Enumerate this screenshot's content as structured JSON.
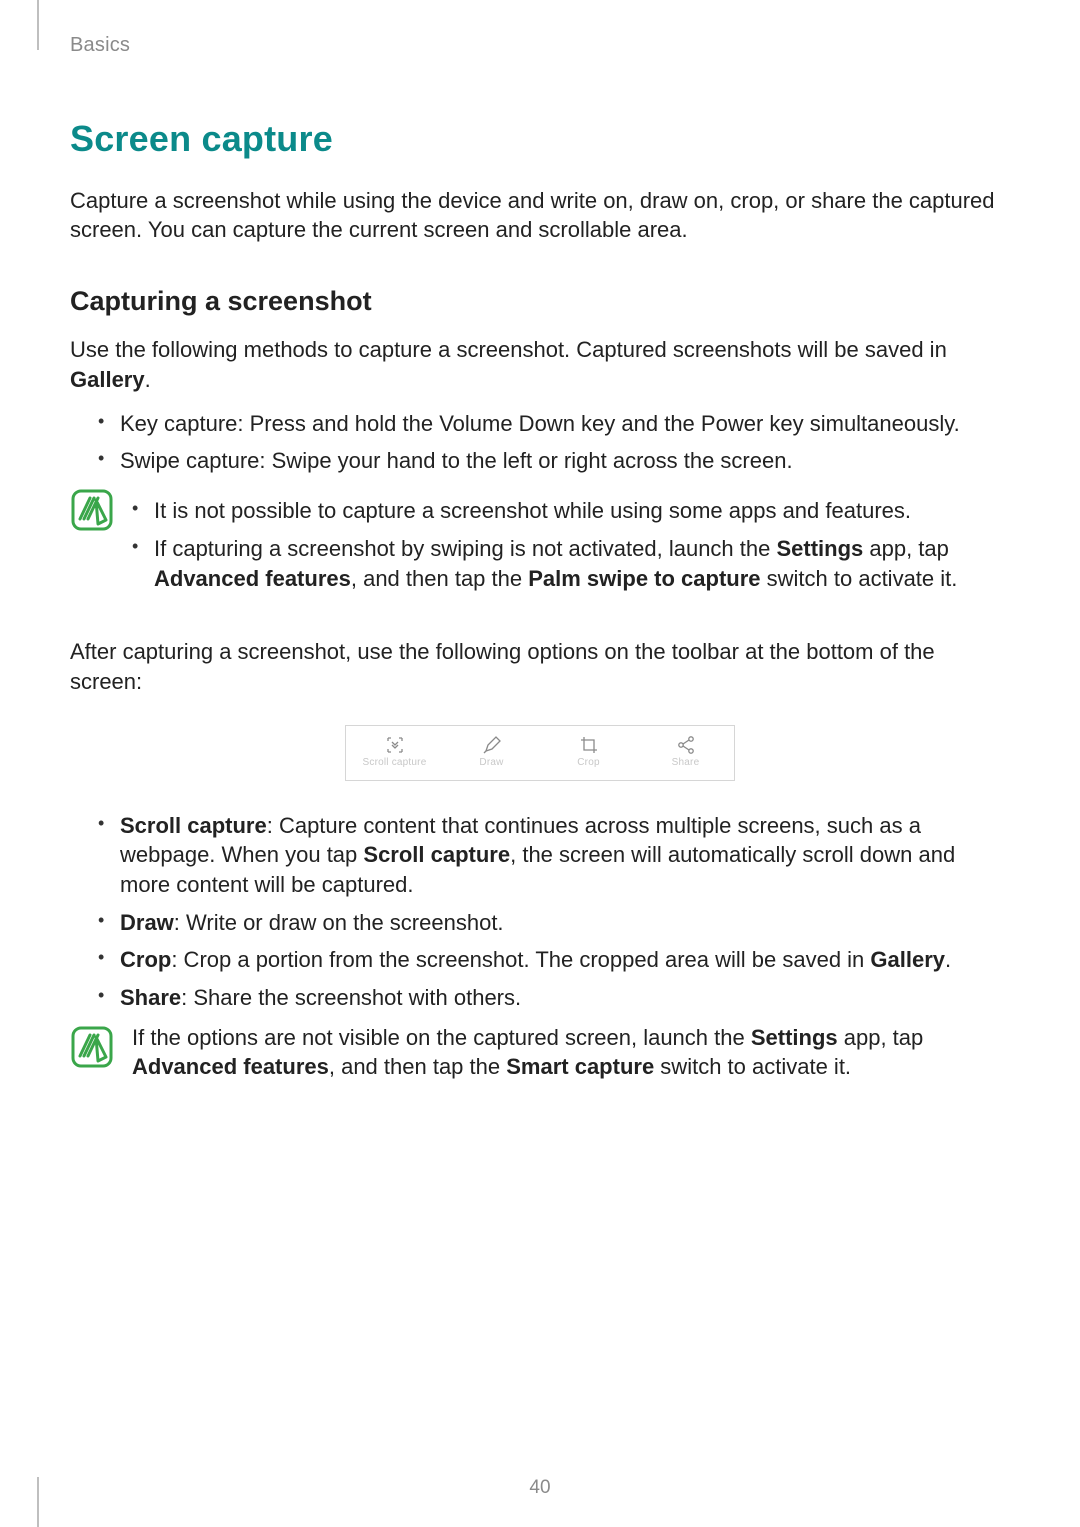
{
  "running_head": "Basics",
  "h1": "Screen capture",
  "intro": "Capture a screenshot while using the device and write on, draw on, crop, or share the captured screen. You can capture the current screen and scrollable area.",
  "h2": "Capturing a screenshot",
  "intro2_pre": "Use the following methods to capture a screenshot. Captured screenshots will be saved in ",
  "gallery_bold": "Gallery",
  "intro2_post": ".",
  "method_bullets": [
    "Key capture: Press and hold the Volume Down key and the Power key simultaneously.",
    "Swipe capture: Swipe your hand to the left or right across the screen."
  ],
  "note1": {
    "b1": "It is not possible to capture a screenshot while using some apps and features.",
    "b2_pre": "If capturing a screenshot by swiping is not activated, launch the ",
    "b2_settings": "Settings",
    "b2_mid": " app, tap ",
    "b2_adv": "Advanced features",
    "b2_mid2": ", and then tap the ",
    "b2_palm": "Palm swipe to capture",
    "b2_post": " switch to activate it."
  },
  "after_capture": "After capturing a screenshot, use the following options on the toolbar at the bottom of the screen:",
  "toolbar": [
    {
      "icon": "scroll-capture-icon",
      "label": "Scroll capture"
    },
    {
      "icon": "draw-icon",
      "label": "Draw"
    },
    {
      "icon": "crop-icon",
      "label": "Crop"
    },
    {
      "icon": "share-icon",
      "label": "Share"
    }
  ],
  "option_bullets": {
    "scroll": {
      "title": "Scroll capture",
      "pre": ": Capture content that continues across multiple screens, such as a webpage. When you tap ",
      "bold_mid": "Scroll capture",
      "post": ", the screen will automatically scroll down and more content will be captured."
    },
    "draw": {
      "title": "Draw",
      "rest": ": Write or draw on the screenshot."
    },
    "crop": {
      "title": "Crop",
      "pre": ": Crop a portion from the screenshot. The cropped area will be saved in ",
      "bold_mid": "Gallery",
      "post": "."
    },
    "share": {
      "title": "Share",
      "rest": ": Share the screenshot with others."
    }
  },
  "note2": {
    "pre": "If the options are not visible on the captured screen, launch the ",
    "settings": "Settings",
    "mid": " app, tap ",
    "adv": "Advanced features",
    "mid2": ", and then tap the ",
    "smart": "Smart capture",
    "post": " switch to activate it."
  },
  "page_number": "40"
}
